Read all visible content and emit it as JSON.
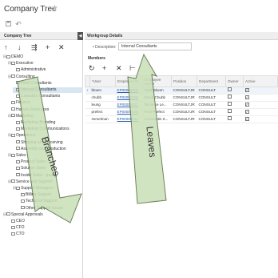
{
  "page": {
    "title": "Company Tree"
  },
  "icons": {
    "star": "star-icon",
    "save": "save-icon",
    "undo": "undo-icon"
  },
  "left_panel": {
    "title": "Company Tree",
    "toolbar": [
      "↑",
      "↓",
      "⇶",
      "+",
      "✕"
    ],
    "tree": [
      {
        "label": "DEMO",
        "level": 0,
        "toggle": "⊟"
      },
      {
        "label": "Executive",
        "level": 1,
        "toggle": "⊟"
      },
      {
        "label": "Administrative",
        "level": 2,
        "toggle": ""
      },
      {
        "label": "Consulting",
        "level": 1,
        "toggle": "⊟"
      },
      {
        "label": "Field Consultants",
        "level": 2,
        "toggle": ""
      },
      {
        "label": "Internal Consultants",
        "level": 2,
        "toggle": "",
        "selected": true
      },
      {
        "label": "Canadian Consultants",
        "level": 2,
        "toggle": ""
      },
      {
        "label": "Finance",
        "level": 1,
        "toggle": ""
      },
      {
        "label": "Human Resources",
        "level": 1,
        "toggle": ""
      },
      {
        "label": "Marketing",
        "level": 1,
        "toggle": "⊟"
      },
      {
        "label": "Marketing Branding",
        "level": 2,
        "toggle": ""
      },
      {
        "label": "Marketing Communications",
        "level": 2,
        "toggle": ""
      },
      {
        "label": "Operations",
        "level": 1,
        "toggle": "⊟"
      },
      {
        "label": "Shipping and Receiving",
        "level": 2,
        "toggle": ""
      },
      {
        "label": "Assembly and Production",
        "level": 2,
        "toggle": ""
      },
      {
        "label": "Sales",
        "level": 1,
        "toggle": "⊟"
      },
      {
        "label": "Product Sales",
        "level": 2,
        "toggle": ""
      },
      {
        "label": "Solution Sales",
        "level": 2,
        "toggle": ""
      },
      {
        "label": "Inside Sales - qualify",
        "level": 2,
        "toggle": ""
      },
      {
        "label": "Service and Support",
        "level": 1,
        "toggle": "⊟"
      },
      {
        "label": "Support Managers",
        "level": 2,
        "toggle": "⊟"
      },
      {
        "label": "Billing Support",
        "level": 3,
        "toggle": ""
      },
      {
        "label": "Technical Support",
        "level": 3,
        "toggle": ""
      },
      {
        "label": "Other Support Issues",
        "level": 3,
        "toggle": ""
      },
      {
        "label": "Special Approvals",
        "level": 0,
        "toggle": "⊟"
      },
      {
        "label": "CEO",
        "level": 1,
        "toggle": ""
      },
      {
        "label": "CFO",
        "level": 1,
        "toggle": ""
      },
      {
        "label": "CTO",
        "level": 1,
        "toggle": ""
      }
    ]
  },
  "right_panel": {
    "title": "Workgroup Details",
    "description_label": "• Description:",
    "description_value": "Internal Consultants",
    "members_label": "Members",
    "grid_toolbar": [
      "↻",
      "+",
      "✕",
      "⊢"
    ],
    "columns": [
      "*User",
      "Employee ID",
      "Employee Name",
      "Position",
      "Department",
      "Owner",
      "Active"
    ],
    "rows": [
      {
        "user": "bloom",
        "emp_id": "EP00000006",
        "name": "Todd Bloom",
        "position": "CONSULTJR",
        "department": "CONSULT",
        "owner": "",
        "active": "✓",
        "selected": true
      },
      {
        "user": "chubb",
        "emp_id": "EP00000008",
        "name": "David Chubb",
        "position": "CONSULTJR",
        "department": "CONSULT",
        "owner": "",
        "active": "✓"
      },
      {
        "user": "leung",
        "emp_id": "EP00000021",
        "name": "Terrance Le...",
        "position": "CONSULTJR",
        "department": "CONSULT",
        "owner": "",
        "active": "✓"
      },
      {
        "user": "prefect",
        "emp_id": "EP00000036",
        "name": "Ford Prefect",
        "position": "CONSULTJR",
        "department": "CONSULT",
        "owner": "",
        "active": "✓"
      },
      {
        "user": "zemelman",
        "emp_id": "EP00000043",
        "name": "Constantin Z...",
        "position": "CONSULTJR",
        "department": "CONSULT",
        "owner": "",
        "active": "✓"
      }
    ]
  },
  "annotations": {
    "branches_label": "Branches",
    "leaves_label": "Leaves",
    "arrow_color": "#c9e0b8",
    "arrow_stroke": "#556b3f"
  }
}
